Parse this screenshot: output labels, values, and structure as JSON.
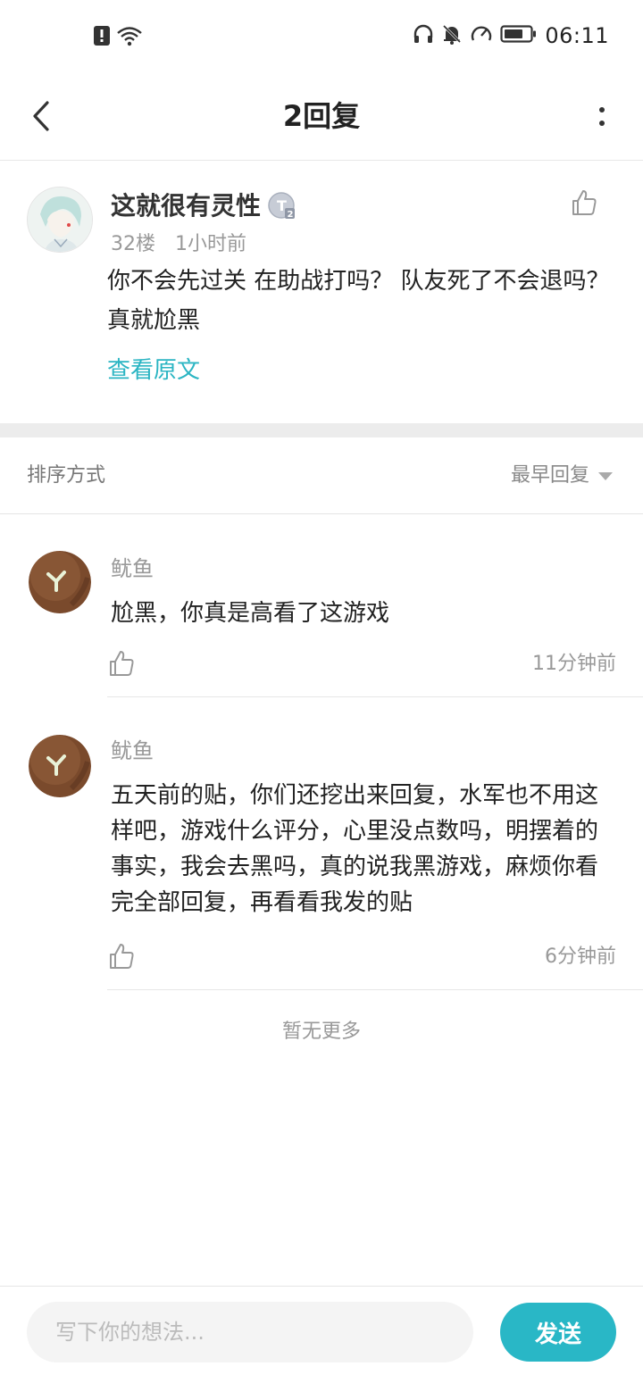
{
  "status_bar": {
    "time": "06:11",
    "left_icons": [
      "alert-icon",
      "wifi-icon"
    ],
    "right_icons": [
      "headphones-icon",
      "bell-muted-icon",
      "speedometer-icon",
      "battery-icon"
    ]
  },
  "header": {
    "title": "2回复",
    "back_icon": "chevron-left-icon",
    "more_icon": "more-vertical-icon"
  },
  "main_post": {
    "author": "这就很有灵性",
    "level_badge": "T2",
    "floor": "32楼",
    "time": "1小时前",
    "content": "你不会先过关 在助战打吗？ 队友死了不会退吗？ 真就尬黑",
    "view_original": "查看原文"
  },
  "sort": {
    "label": "排序方式",
    "selected": "最早回复"
  },
  "replies": [
    {
      "author": "鱿鱼",
      "content": "尬黑，你真是高看了这游戏",
      "time": "11分钟前"
    },
    {
      "author": "鱿鱼",
      "content": "五天前的贴，你们还挖出来回复，水军也不用这样吧，游戏什么评分，心里没点数吗，明摆着的事实，我会去黑吗，真的说我黑游戏，麻烦你看完全部回复，再看看我发的贴",
      "time": "6分钟前"
    }
  ],
  "footer": {
    "no_more": "暂无更多"
  },
  "input_bar": {
    "placeholder": "写下你的想法...",
    "send_label": "发送"
  },
  "colors": {
    "accent": "#29b7c6",
    "link": "#2bb5c3",
    "muted_text": "#999999",
    "divider": "#e6e6e6"
  }
}
